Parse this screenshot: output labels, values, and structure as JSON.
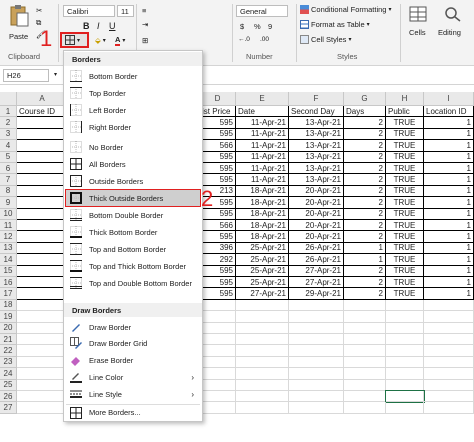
{
  "ribbon": {
    "paste": "Paste",
    "clipboard": "Clipboard",
    "font_name": "Calibri",
    "font_size": "11",
    "bold": "B",
    "italic": "I",
    "underline": "U",
    "number_format": "General",
    "number_label": "Number",
    "currency": "$",
    "percent": "%",
    "comma": "9",
    "dec_inc": "←.0",
    "dec_dec": ".00",
    "conditional": "Conditional Formatting",
    "format_table": "Format as Table",
    "cell_styles": "Cell Styles",
    "styles": "Styles",
    "cells": "Cells",
    "editing": "Editing",
    "accent_red": "#e02020"
  },
  "formula_bar": {
    "name_box": "H26"
  },
  "columns": [
    "A",
    "B",
    "C",
    "D",
    "E",
    "F",
    "G",
    "H",
    "I"
  ],
  "header_row": [
    "Course ID",
    "",
    "",
    "ist Price",
    "Date",
    "Second Day",
    "Days",
    "Public",
    "Location ID"
  ],
  "rows": [
    {
      "d": "595",
      "e": "11-Apr-21",
      "f": "13-Apr-21",
      "g": "2",
      "h": "TRUE",
      "i": "1"
    },
    {
      "d": "595",
      "e": "11-Apr-21",
      "f": "13-Apr-21",
      "g": "2",
      "h": "TRUE",
      "i": "1"
    },
    {
      "d": "566",
      "e": "11-Apr-21",
      "f": "13-Apr-21",
      "g": "2",
      "h": "TRUE",
      "i": "1"
    },
    {
      "d": "595",
      "e": "11-Apr-21",
      "f": "13-Apr-21",
      "g": "2",
      "h": "TRUE",
      "i": "1"
    },
    {
      "d": "595",
      "e": "11-Apr-21",
      "f": "13-Apr-21",
      "g": "2",
      "h": "TRUE",
      "i": "1"
    },
    {
      "d": "595",
      "e": "11-Apr-21",
      "f": "13-Apr-21",
      "g": "2",
      "h": "TRUE",
      "i": "1"
    },
    {
      "d": "213",
      "e": "18-Apr-21",
      "f": "20-Apr-21",
      "g": "2",
      "h": "TRUE",
      "i": "1"
    },
    {
      "d": "595",
      "e": "18-Apr-21",
      "f": "20-Apr-21",
      "g": "2",
      "h": "TRUE",
      "i": "1"
    },
    {
      "d": "595",
      "e": "18-Apr-21",
      "f": "20-Apr-21",
      "g": "2",
      "h": "TRUE",
      "i": "1"
    },
    {
      "d": "566",
      "e": "18-Apr-21",
      "f": "20-Apr-21",
      "g": "2",
      "h": "TRUE",
      "i": "1"
    },
    {
      "d": "595",
      "e": "18-Apr-21",
      "f": "20-Apr-21",
      "g": "2",
      "h": "TRUE",
      "i": "1"
    },
    {
      "d": "396",
      "e": "25-Apr-21",
      "f": "26-Apr-21",
      "g": "1",
      "h": "TRUE",
      "i": "1"
    },
    {
      "d": "292",
      "e": "25-Apr-21",
      "f": "26-Apr-21",
      "g": "1",
      "h": "TRUE",
      "i": "1"
    },
    {
      "d": "595",
      "e": "25-Apr-21",
      "f": "27-Apr-21",
      "g": "2",
      "h": "TRUE",
      "i": "1"
    },
    {
      "d": "595",
      "e": "25-Apr-21",
      "f": "27-Apr-21",
      "g": "2",
      "h": "TRUE",
      "i": "1"
    },
    {
      "d": "595",
      "e": "27-Apr-21",
      "f": "29-Apr-21",
      "g": "2",
      "h": "TRUE",
      "i": "1"
    }
  ],
  "row_numbers": [
    "1",
    "2",
    "3",
    "4",
    "5",
    "6",
    "7",
    "8",
    "9",
    "10",
    "11",
    "12",
    "13",
    "14",
    "15",
    "16",
    "17",
    "18",
    "19",
    "20",
    "21",
    "22",
    "23",
    "24",
    "25",
    "26",
    "27"
  ],
  "menu": {
    "borders_head": "Borders",
    "draw_head": "Draw Borders",
    "items": [
      "Bottom Border",
      "Top Border",
      "Left Border",
      "Right Border",
      "No Border",
      "All Borders",
      "Outside Borders",
      "Thick Outside Borders",
      "Bottom Double Border",
      "Thick Bottom Border",
      "Top and Bottom Border",
      "Top and Thick Bottom Border",
      "Top and Double Bottom Border"
    ],
    "draw_items": [
      "Draw Border",
      "Draw Border Grid",
      "Erase Border",
      "Line Color",
      "Line Style",
      "More Borders..."
    ]
  },
  "annotations": {
    "step1": "1",
    "step2": "2"
  }
}
